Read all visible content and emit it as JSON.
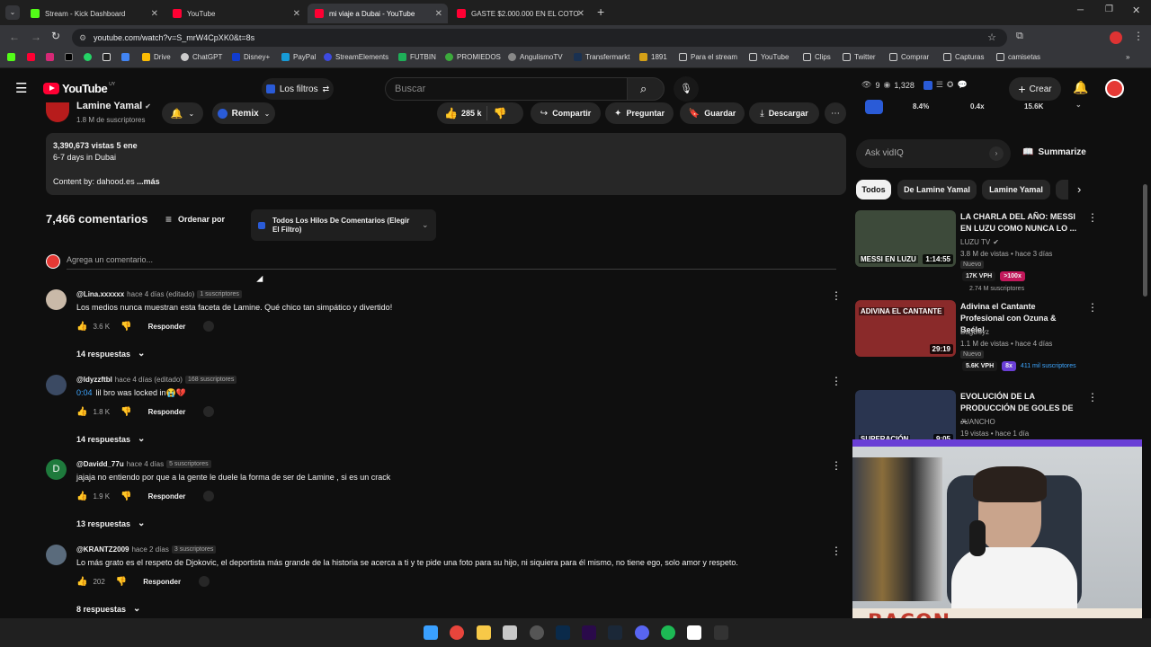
{
  "browser": {
    "tabs": [
      {
        "title": "Stream - Kick Dashboard",
        "color": "#53fc18"
      },
      {
        "title": "YouTube",
        "color": "#ff0033"
      },
      {
        "title": "mi viaje a Dubai - YouTube",
        "color": "#ff0033"
      },
      {
        "title": "GASTE $2.000.000 EN EL COTO",
        "color": "#ff0033"
      }
    ],
    "url": "youtube.com/watch?v=S_mrW4CpXK0&t=8s",
    "bookmarks": [
      "Drive",
      "ChatGPT",
      "Disney+",
      "PayPal",
      "StreamElements",
      "FUTBIN",
      "PROMIEDOS",
      "AngulismoTV",
      "Transfermarkt",
      "1891",
      "Para el stream",
      "YouTube",
      "Clips",
      "Twitter",
      "Comprar",
      "Capturas",
      "camisetas"
    ]
  },
  "yt": {
    "logo": "YouTube",
    "logo_sup": "UY",
    "filters_label": "Los filtros",
    "search_placeholder": "Buscar",
    "create_label": "Crear",
    "vidiq_stats": {
      "a": "9",
      "b": "1,328"
    }
  },
  "channel": {
    "name": "Lamine Yamal",
    "subs": "1.8 M de suscriptores",
    "remix": "Remix"
  },
  "actions": {
    "likes": "285 k",
    "share": "Compartir",
    "ask": "Preguntar",
    "save": "Guardar",
    "download": "Descargar"
  },
  "description": {
    "stats": "3,390,673 vistas  5 ene",
    "line2": "6-7 days in Dubai",
    "line3": "Content by: dahood.es",
    "more": "...más"
  },
  "comments_header": {
    "count": "7,466 comentarios",
    "sort": "Ordenar por",
    "filter": "Todos Los Hilos De Comentarios (Elegir El Filtro)",
    "add_placeholder": "Agrega un comentario..."
  },
  "comments": [
    {
      "user": "@Lina.xxxxxx",
      "meta": "hace 4 días (editado)",
      "badge": "1 suscriptores",
      "text": "Los medios nunca muestran esta faceta de Lamine. Qué chico tan simpático y divertido!",
      "likes": "3.6 K",
      "reply": "Responder",
      "replies": "14 respuestas",
      "avatar": "#c9b9a8"
    },
    {
      "user": "@ldyzzftbl",
      "meta": "hace 4 días (editado)",
      "badge": "168 suscriptores",
      "text": "lil bro was locked in😭💔",
      "ts": "0:04",
      "likes": "1.8 K",
      "reply": "Responder",
      "replies": "14 respuestas",
      "avatar": "#3b4a63"
    },
    {
      "user": "@Davidd_77u",
      "meta": "hace 4 días",
      "badge": "5 suscriptores",
      "text": "jajaja no entiendo por que a la gente le duele la forma de ser de Lamine , si es un crack",
      "likes": "1.9 K",
      "reply": "Responder",
      "replies": "13 respuestas",
      "avatar": "#1e7a3c",
      "initial": "D"
    },
    {
      "user": "@KRANTZ2009",
      "meta": "hace 2 días",
      "badge": "3 suscriptores",
      "text": "Lo más grato es el respeto de Djokovic, el deportista más grande de la historia se acerca a ti y te pide una foto para su hijo, ni siquiera para él mismo, no tiene ego, solo amor y respeto.",
      "likes": "202",
      "reply": "Responder",
      "replies": "8 respuestas",
      "avatar": "#5a6b7c"
    }
  ],
  "sidebar": {
    "stats": [
      "8.4%",
      "0.4x",
      "15.6K"
    ],
    "ask_placeholder": "Ask vidIQ",
    "summarize": "Summarize",
    "chips": [
      "Todos",
      "De Lamine Yamal",
      "Lamine Yamal"
    ],
    "recs": [
      {
        "title": "LA CHARLA DEL AÑO: MESSI EN LUZU COMO NUNCA LO ...",
        "channel": "LUZU TV",
        "meta": "3.8 M de vistas • hace 3 días",
        "badge": "Nuevo",
        "vph": "17K VPH",
        "mult": ">100x",
        "subs": "2.74 M suscriptores",
        "duration": "1:14:55",
        "overlay": "MESSI EN LUZU",
        "thumb": "#3d4a3a"
      },
      {
        "title": "Adivina el Cantante Profesional con Ozuna & Beéle!",
        "channel": "BagBoyz",
        "meta": "1.1 M de vistas • hace 4 días",
        "badge": "Nuevo",
        "vph": "5.6K VPH",
        "mult": "8x",
        "subs": "411 mil suscriptores",
        "duration": "29:19",
        "overlay": "ADIVINA EL CANTANTE",
        "thumb": "#8a2a2a"
      },
      {
        "title": "EVOLUCIÓN DE LA PRODUCCIÓN DE GOLES DE ...",
        "channel": "JUANCHO",
        "meta": "19 vistas • hace 1 día",
        "duration": "9:05",
        "overlay": "SUPERACIÓN",
        "thumb": "#2a3550"
      }
    ],
    "webcam_label": "BACON"
  }
}
